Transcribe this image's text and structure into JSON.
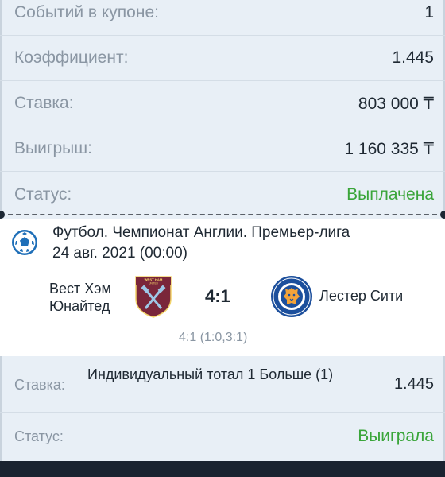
{
  "summary": {
    "events_label": "Событий в купоне:",
    "events_value": "1",
    "coef_label": "Коэффициент:",
    "coef_value": "1.445",
    "stake_label": "Ставка:",
    "stake_value": "803 000 ₸",
    "win_label": "Выигрыш:",
    "win_value": "1 160 335 ₸",
    "status_label": "Статус:",
    "status_value": "Выплачена"
  },
  "event": {
    "sport_icon": "soccer-ball-icon",
    "tournament": "Футбол. Чемпионат Англии. Премьер-лига",
    "date": "24 авг. 2021 (00:00)",
    "team1": "Вест Хэм Юнайтед",
    "team1_crest": "west-ham-crest-icon",
    "team1_crest_text": "WEST HAM UNITED",
    "score": "4:1",
    "team2": "Лестер Сити",
    "team2_crest": "leicester-crest-icon",
    "team2_crest_text": "LEICESTER CITY FOOTBALL CLUB",
    "detail_score": "4:1 (1:0,3:1)"
  },
  "bet": {
    "label": "Ставка:",
    "description": "Индивидуальный тотал 1 Больше (1)",
    "odd": "1.445",
    "status_label": "Статус:",
    "status_value": "Выиграла"
  },
  "colors": {
    "background": "#e8eff6",
    "card": "#ffffff",
    "success": "#3aa53a",
    "label": "#8a96a3",
    "text": "#1f2933",
    "bottom_bar": "#1a2330"
  }
}
